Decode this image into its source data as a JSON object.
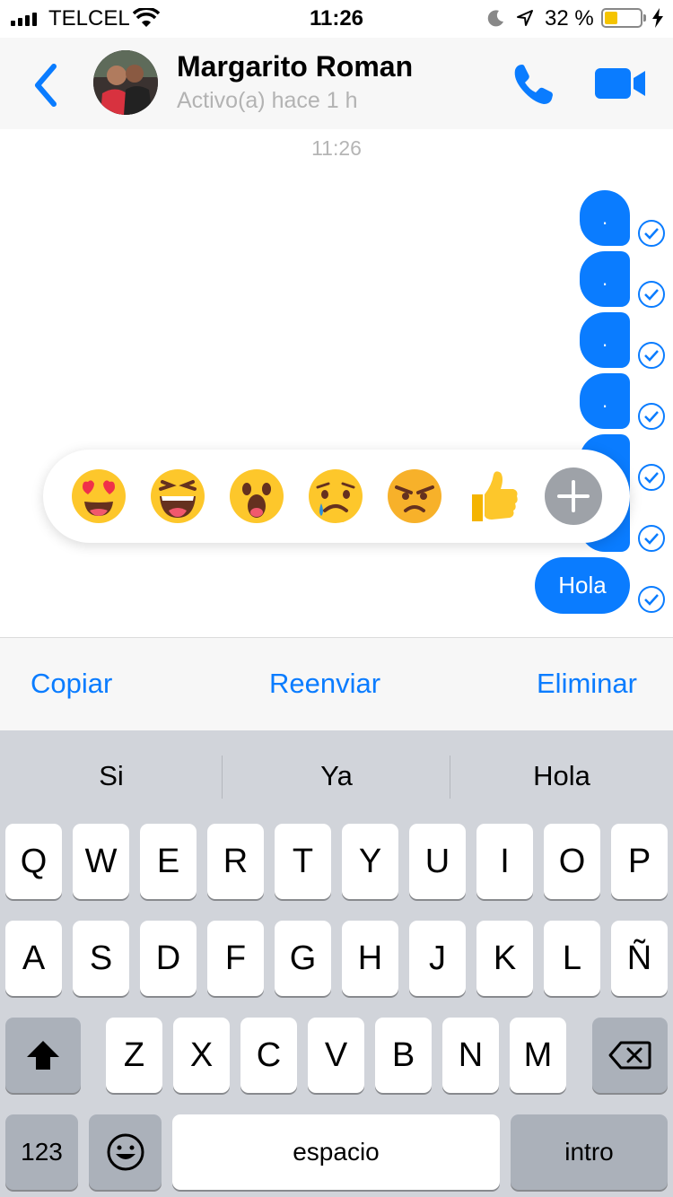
{
  "status_bar": {
    "carrier": "TELCEL",
    "time": "11:26",
    "battery_percent": "32 %",
    "battery_level": 0.32
  },
  "header": {
    "contact_name": "Margarito Roman",
    "activity": "Activo(a) hace 1 h",
    "icons": [
      "chevron-left-icon",
      "avatar",
      "phone-icon",
      "video-camera-icon"
    ],
    "accent": "#0a7cff"
  },
  "chat": {
    "timestamp": "11:26",
    "dot_messages": [
      ".",
      ".",
      ".",
      "."
    ],
    "last_message": "Hola"
  },
  "reactions": [
    "heart-eyes",
    "laughing",
    "surprised",
    "crying",
    "angry",
    "thumbs-up",
    "plus-icon"
  ],
  "actions": {
    "copy": "Copiar",
    "forward": "Reenviar",
    "delete": "Eliminar"
  },
  "keyboard": {
    "suggestions": [
      "Si",
      "Ya",
      "Hola"
    ],
    "row1": [
      "Q",
      "W",
      "E",
      "R",
      "T",
      "Y",
      "U",
      "I",
      "O",
      "P"
    ],
    "row2": [
      "A",
      "S",
      "D",
      "F",
      "G",
      "H",
      "J",
      "K",
      "L",
      "Ñ"
    ],
    "row3": [
      "Z",
      "X",
      "C",
      "V",
      "B",
      "N",
      "M"
    ],
    "numbers_key": "123",
    "space_key": "espacio",
    "return_key": "intro"
  }
}
